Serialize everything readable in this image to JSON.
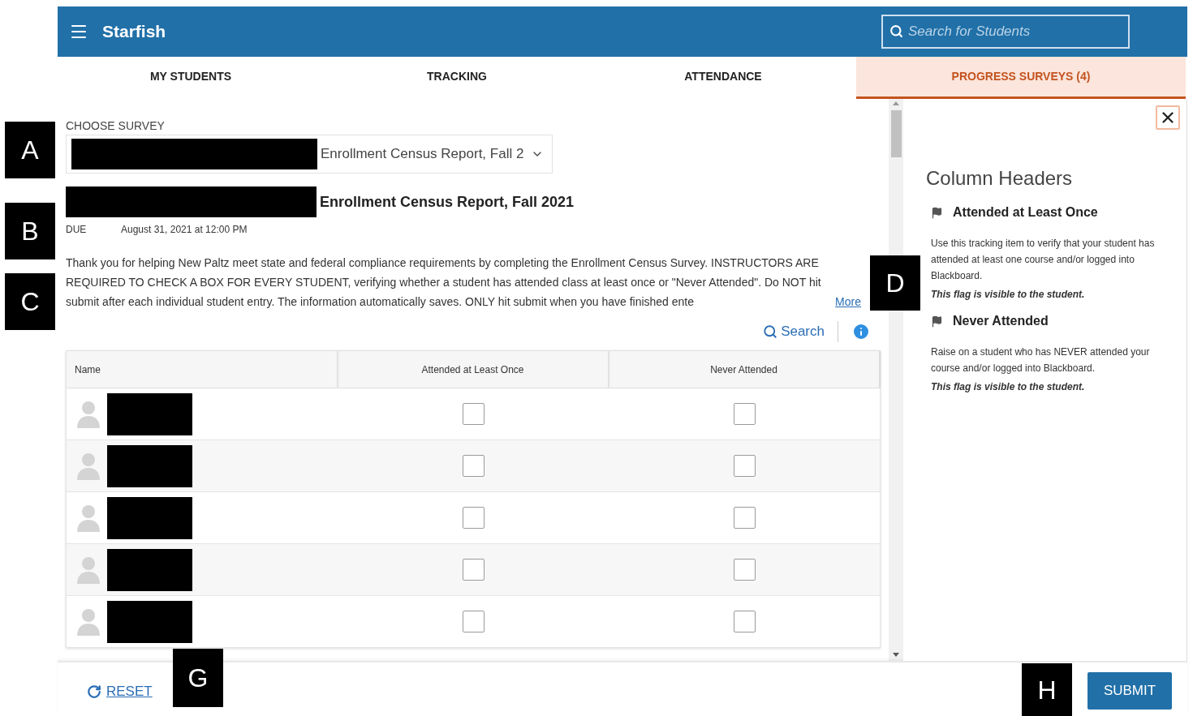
{
  "callouts": [
    {
      "label": "A"
    },
    {
      "label": "B"
    },
    {
      "label": "C"
    },
    {
      "label": "D"
    },
    {
      "label": "G"
    },
    {
      "label": "H"
    }
  ],
  "header": {
    "title": "Starfish",
    "search": {
      "placeholder": "Search for Students"
    }
  },
  "tabs": [
    {
      "label": "MY STUDENTS",
      "selected": false
    },
    {
      "label": "TRACKING",
      "selected": false
    },
    {
      "label": "ATTENDANCE",
      "selected": false
    },
    {
      "label": "PROGRESS SURVEYS (4)",
      "selected": true
    }
  ],
  "survey": {
    "label": "CHOOSE SURVEY",
    "value": "Enrollment Census Report, Fall 2"
  },
  "title": "Enrollment Census Report, Fall 2021",
  "due": {
    "label": "DUE",
    "value": "August 31, 2021 at 12:00 PM"
  },
  "description": "Thank you for helping New Paltz meet state and federal compliance requirements by completing the Enrollment Census Survey. INSTRUCTORS ARE REQUIRED TO CHECK A BOX FOR EVERY STUDENT, verifying whether a student has attended class at least once or \"Never Attended\". Do NOT hit submit after each individual student entry. The information automatically saves. ONLY hit submit when you have finished ente",
  "more": "More",
  "search_link": "Search",
  "table": {
    "columns": [
      "Name",
      "Attended at Least Once",
      "Never Attended"
    ],
    "rows": [
      {
        "attended": false,
        "never": false
      },
      {
        "attended": false,
        "never": false
      },
      {
        "attended": false,
        "never": false
      },
      {
        "attended": false,
        "never": false
      },
      {
        "attended": false,
        "never": false
      }
    ]
  },
  "panel": {
    "title": "Column Headers",
    "items": [
      {
        "heading": "Attended at Least Once",
        "text": "Use this tracking item to verify that your student has attended at least one course and/or logged into Blackboard.",
        "note": "This flag is visible to the student."
      },
      {
        "heading": "Never Attended",
        "text": "Raise on a student who has NEVER attended your course and/or logged into Blackboard.",
        "note": "This flag is visible to the student."
      }
    ]
  },
  "footer": {
    "reset": "RESET",
    "submit": "SUBMIT"
  }
}
